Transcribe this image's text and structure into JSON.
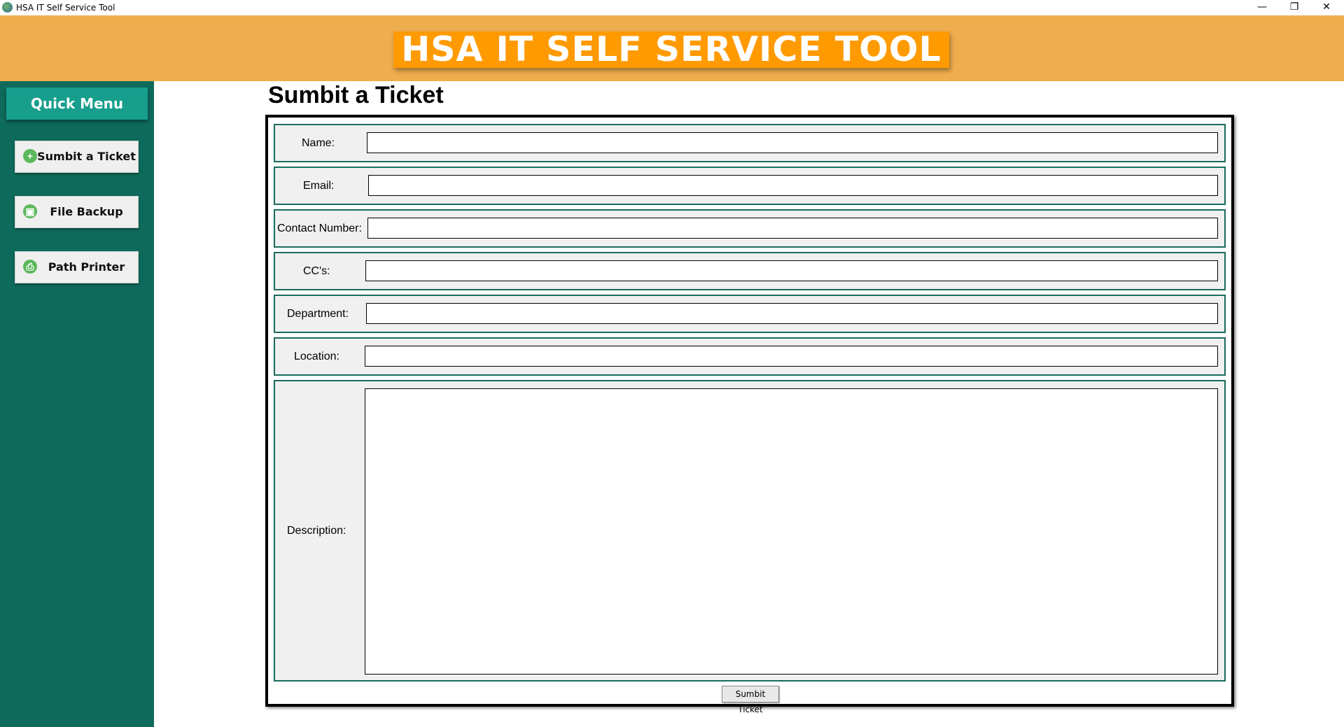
{
  "window": {
    "title": "HSA IT Self Service Tool",
    "minimize": "—",
    "maximize": "❐",
    "close": "✕"
  },
  "header": {
    "banner_text": "HSA IT SELF SERVICE TOOL"
  },
  "sidebar": {
    "heading": "Quick Menu",
    "items": [
      {
        "label": "Sumbit a Ticket",
        "icon": "plus-circle-icon"
      },
      {
        "label": "File Backup",
        "icon": "backup-icon"
      },
      {
        "label": "Path Printer",
        "icon": "printer-icon"
      }
    ]
  },
  "main": {
    "title": "Sumbit a Ticket",
    "fields": [
      {
        "label": "Name:",
        "value": ""
      },
      {
        "label": "Email:",
        "value": ""
      },
      {
        "label": "Contact Number:",
        "value": ""
      },
      {
        "label": "CC's:",
        "value": ""
      },
      {
        "label": "Department:",
        "value": ""
      },
      {
        "label": "Location:",
        "value": ""
      },
      {
        "label": "Description:",
        "value": ""
      }
    ],
    "submit_label": "Sumbit Ticket"
  },
  "colors": {
    "header_bg": "#f0ad4e",
    "banner_bg": "#ff9a00",
    "sidebar_bg": "#0e6b5b",
    "quickmenu_bg": "#179e8d",
    "row_border": "#1a6b5d"
  }
}
